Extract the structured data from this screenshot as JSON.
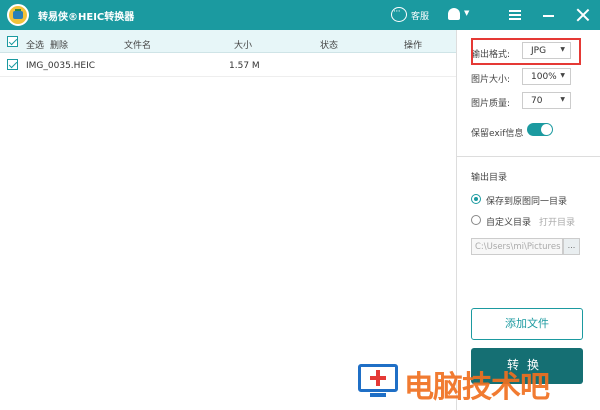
{
  "app": {
    "title": "转易侠®HEIC转换器"
  },
  "titlebar": {
    "service_label": "客服"
  },
  "table": {
    "headers": {
      "select_all": "全选",
      "delete": "删除",
      "file_name": "文件名",
      "size": "大小",
      "status": "状态",
      "action": "操作"
    },
    "rows": [
      {
        "file_name": "IMG_0035.HEIC",
        "size": "1.57 M",
        "status": "",
        "checked": true
      }
    ]
  },
  "settings": {
    "format_label": "输出格式:",
    "format_value": "JPG",
    "size_label": "图片大小:",
    "size_value": "100%",
    "quality_label": "图片质量:",
    "quality_value": "70",
    "exif_label": "保留exif信息",
    "exif_on": true
  },
  "output": {
    "section_label": "输出目录",
    "option_same": "保存到原图同一目录",
    "option_custom": "自定义目录",
    "open_dir": "打开目录",
    "path_placeholder": "C:\\Users\\mi\\Pictures",
    "browse_label": "..."
  },
  "buttons": {
    "add_file": "添加文件",
    "convert": "转换"
  },
  "watermark": {
    "text": "电脑技术吧"
  },
  "colors": {
    "accent": "#1b9aa0",
    "highlight": "#e53935",
    "watermark": "#f07020"
  }
}
